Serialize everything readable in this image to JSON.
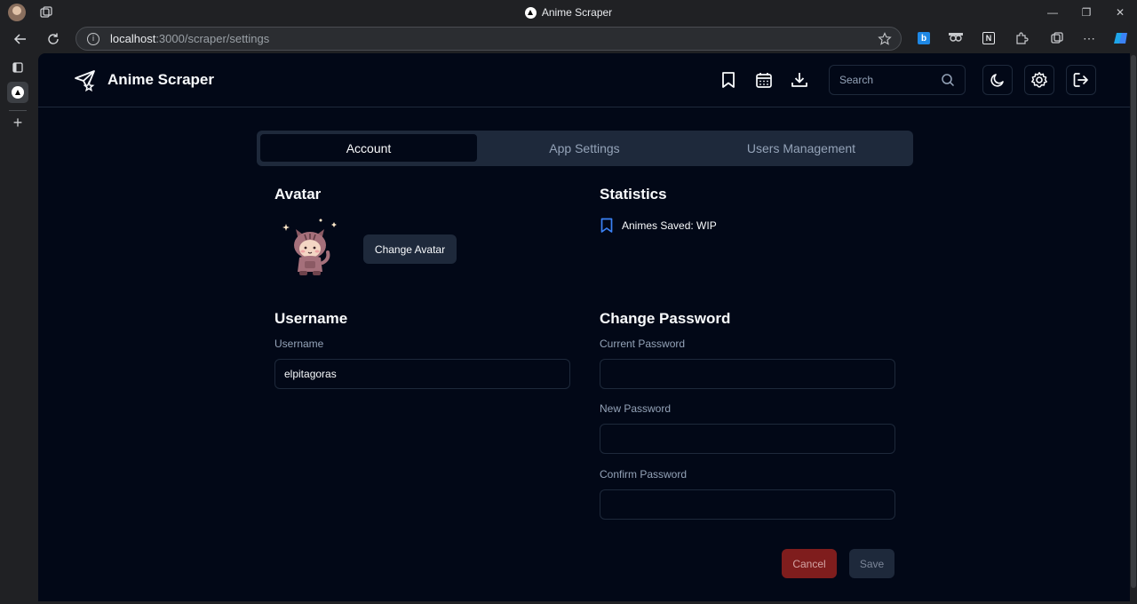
{
  "browser": {
    "window_title": "Anime Scraper",
    "url_host": "localhost",
    "url_path": ":3000/scraper/settings"
  },
  "app": {
    "brand_name": "Anime Scraper",
    "search_placeholder": "Search"
  },
  "tabs": [
    {
      "label": "Account",
      "active": true
    },
    {
      "label": "App Settings",
      "active": false
    },
    {
      "label": "Users Management",
      "active": false
    }
  ],
  "avatar": {
    "heading": "Avatar",
    "change_button": "Change Avatar"
  },
  "statistics": {
    "heading": "Statistics",
    "animes_saved": "Animes Saved: WIP"
  },
  "username": {
    "heading": "Username",
    "label": "Username",
    "value": "elpitagoras"
  },
  "password": {
    "heading": "Change Password",
    "current_label": "Current Password",
    "new_label": "New Password",
    "confirm_label": "Confirm Password"
  },
  "actions": {
    "cancel": "Cancel",
    "save": "Save"
  },
  "colors": {
    "page_bg": "#020817",
    "border": "#1e293b",
    "cancel_bg": "#7f1d1d",
    "stat_icon": "#3b82f6"
  }
}
